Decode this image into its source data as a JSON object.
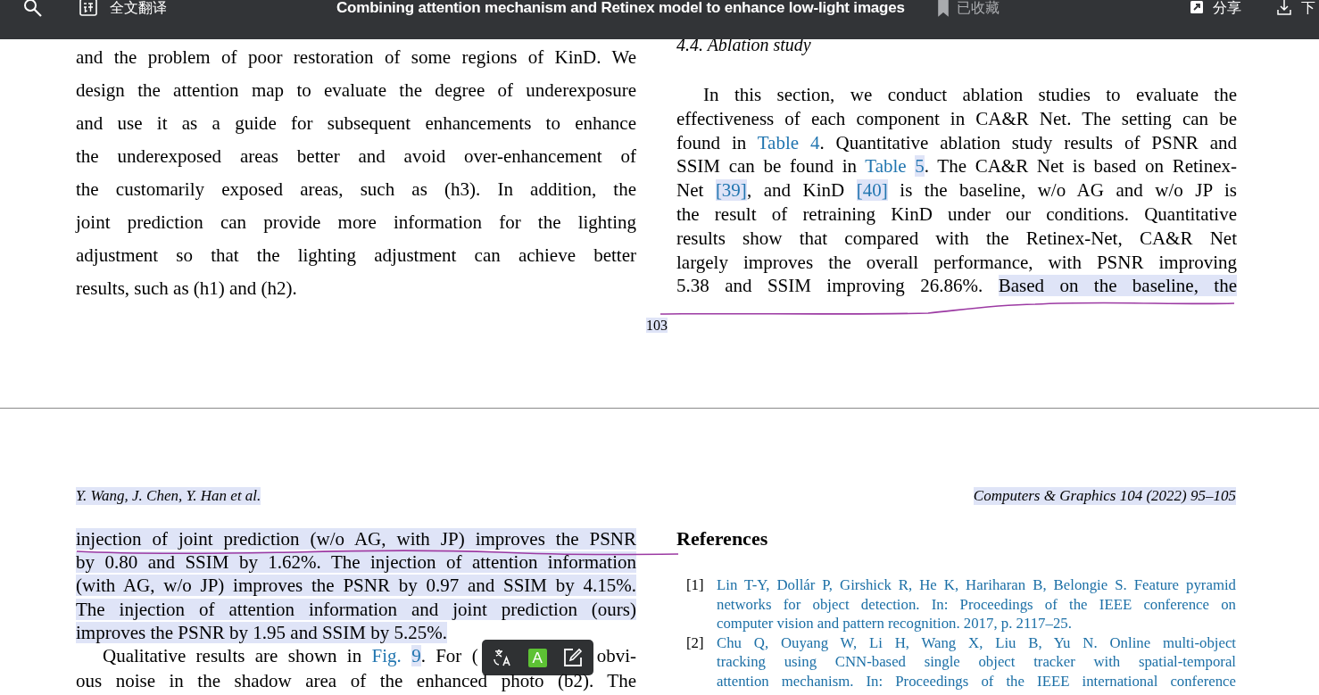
{
  "top_bar": {
    "translate_label": "全文翻译",
    "title": "Combining attention mechanism and Retinex model to enhance low-light images",
    "bookmark": {
      "label": "已收藏",
      "saved": true
    },
    "share_label": "分享",
    "download_label": "下"
  },
  "pages": [
    {
      "columns": [
        {
          "blocks": [
            {
              "kind": "paragraph",
              "indent": false,
              "continues": false,
              "lines": [
                [
                  {
                    "kind": "text",
                    "text": "and the problem of poor restoration of some regions of KinD. We",
                    "highlighted": false
                  }
                ],
                [
                  {
                    "kind": "text",
                    "text": "design the attention map to evaluate the degree of underexposure",
                    "highlighted": false
                  }
                ],
                [
                  {
                    "kind": "text",
                    "text": "and use it as a guide for subsequent enhancements to enhance",
                    "highlighted": false
                  }
                ],
                [
                  {
                    "kind": "text",
                    "text": "the underexposed areas better and avoid over-enhancement of",
                    "highlighted": false
                  }
                ],
                [
                  {
                    "kind": "text",
                    "text": "the customarily exposed areas, such as (h3). In addition, the",
                    "highlighted": false
                  }
                ],
                [
                  {
                    "kind": "text",
                    "text": "joint prediction can provide more information for the lighting",
                    "highlighted": false
                  }
                ],
                [
                  {
                    "kind": "text",
                    "text": "adjustment so that the lighting adjustment can achieve better",
                    "highlighted": false
                  }
                ],
                [
                  {
                    "kind": "text",
                    "text": "results, such as (h1) and (h2).",
                    "highlighted": false
                  }
                ]
              ]
            }
          ]
        },
        {
          "blocks": [
            {
              "kind": "heading",
              "text": "4.4. Ablation study"
            },
            {
              "kind": "paragraph",
              "indent": true,
              "continues": true,
              "lines": [
                [
                  {
                    "kind": "text",
                    "text": "In this section, we conduct ablation studies to evaluate the",
                    "highlighted": false
                  }
                ],
                [
                  {
                    "kind": "text",
                    "text": "effectiveness of each component in CA&R Net. The setting can be",
                    "highlighted": false
                  }
                ],
                [
                  {
                    "kind": "text",
                    "text": "found in ",
                    "highlighted": false
                  },
                  {
                    "kind": "link",
                    "parts": [
                      {
                        "text": "Table 4",
                        "highlighted": false
                      }
                    ]
                  },
                  {
                    "kind": "text",
                    "text": ". Quantitative ablation study results of PSNR and",
                    "highlighted": false
                  }
                ],
                [
                  {
                    "kind": "text",
                    "text": "SSIM can be found in ",
                    "highlighted": false
                  },
                  {
                    "kind": "link",
                    "parts": [
                      {
                        "text": "Table ",
                        "highlighted": false
                      },
                      {
                        "text": "5",
                        "highlighted": true
                      }
                    ]
                  },
                  {
                    "kind": "text",
                    "text": ". The CA&R Net is based on Retinex-",
                    "highlighted": false
                  }
                ],
                [
                  {
                    "kind": "text",
                    "text": "Net ",
                    "highlighted": false
                  },
                  {
                    "kind": "link",
                    "parts": [
                      {
                        "text": "[39]",
                        "highlighted": true
                      }
                    ]
                  },
                  {
                    "kind": "text",
                    "text": ", and KinD ",
                    "highlighted": false
                  },
                  {
                    "kind": "link",
                    "parts": [
                      {
                        "text": "[40]",
                        "highlighted": true
                      }
                    ]
                  },
                  {
                    "kind": "text",
                    "text": " is the baseline, w/o AG and w/o JP is",
                    "highlighted": false
                  }
                ],
                [
                  {
                    "kind": "text",
                    "text": "the result of retraining KinD under our conditions. Quantitative",
                    "highlighted": false
                  }
                ],
                [
                  {
                    "kind": "text",
                    "text": "results show that compared with the Retinex-Net, CA&R Net",
                    "highlighted": false
                  }
                ],
                [
                  {
                    "kind": "text",
                    "text": "largely improves the overall performance, with PSNR improving",
                    "highlighted": false
                  }
                ],
                [
                  {
                    "kind": "text",
                    "text": "5.38 and SSIM improving 26.86%. ",
                    "highlighted": false
                  },
                  {
                    "kind": "text",
                    "text": "Based on the baseline, the",
                    "highlighted": true
                  }
                ]
              ]
            }
          ]
        }
      ],
      "page_number": {
        "text": "103",
        "highlighted": true
      }
    },
    {
      "header": {
        "authors": {
          "text": "Y. Wang, J. Chen, Y. Han et al.",
          "highlighted": true
        },
        "journal": {
          "text": "Computers & Graphics 104 (2022) 95–105",
          "highlighted": true
        }
      },
      "columns": [
        {
          "blocks": [
            {
              "kind": "paragraph",
              "indent": false,
              "continues": false,
              "lines": [
                [
                  {
                    "kind": "text",
                    "text": "injection of joint prediction (w/o AG, with JP) improves the PSNR",
                    "highlighted": true
                  }
                ],
                [
                  {
                    "kind": "text",
                    "text": "by 0.80 and SSIM by 1.62%. The injection of attention information",
                    "highlighted": true
                  }
                ],
                [
                  {
                    "kind": "text",
                    "text": "(with AG, w/o JP) improves the PSNR by 0.97 and SSIM by 4.15%.",
                    "highlighted": true
                  }
                ],
                [
                  {
                    "kind": "text",
                    "text": "The injection of attention information and joint prediction (ours)",
                    "highlighted": true
                  }
                ],
                [
                  {
                    "kind": "text",
                    "text": "improves the PSNR by 1.95 and SSIM by 5.25%.",
                    "highlighted": true
                  }
                ]
              ]
            },
            {
              "kind": "paragraph",
              "indent": true,
              "continues": true,
              "lines": [
                [
                  {
                    "kind": "text",
                    "text": "Qualitative results are shown in ",
                    "highlighted": false
                  },
                  {
                    "kind": "link",
                    "parts": [
                      {
                        "text": "Fig. ",
                        "highlighted": false
                      },
                      {
                        "text": "9",
                        "highlighted": true
                      }
                    ]
                  },
                  {
                    "kind": "text",
                    "text": ". For (",
                    "highlighted": false
                  },
                  {
                    "kind": "toolbar",
                    "buttons": [
                      {
                        "kind": "translate"
                      },
                      {
                        "kind": "highlight",
                        "label": "A"
                      },
                      {
                        "kind": "note"
                      }
                    ]
                  },
                  {
                    "kind": "text",
                    "text": "obvi-",
                    "highlighted": false
                  }
                ],
                [
                  {
                    "kind": "text",
                    "text": "ous noise in the shadow area of the enhanced photo (b2). The",
                    "highlighted": false
                  }
                ]
              ]
            }
          ]
        },
        {
          "blocks": [
            {
              "kind": "section_title",
              "text": "References"
            },
            {
              "kind": "reference",
              "number": "[1]",
              "continues": false,
              "lines": [
                "Lin T-Y, Dollár P, Girshick R, He K, Hariharan B, Belongie S. Feature pyramid",
                "networks for object detection. In: Proceedings of the IEEE conference on",
                "computer vision and pattern recognition. 2017, p. 2117–25."
              ]
            },
            {
              "kind": "reference",
              "number": "[2]",
              "continues": true,
              "lines": [
                "Chu Q, Ouyang W, Li H, Wang X, Liu B, Yu N. Online multi-object",
                "tracking using CNN-based single object tracker with spatial-temporal",
                "attention mechanism. In: Proceedings of the IEEE international conference"
              ]
            }
          ]
        }
      ]
    }
  ]
}
